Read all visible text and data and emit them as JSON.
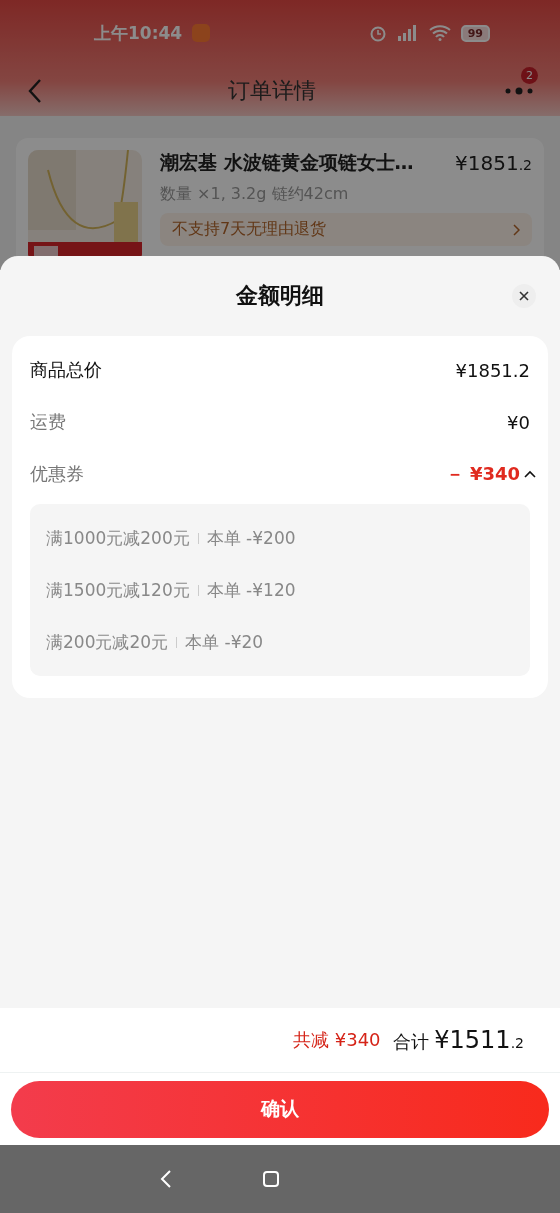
{
  "status_bar": {
    "time": "上午10:44",
    "battery": "99"
  },
  "header": {
    "title": "订单详情",
    "badge": "2"
  },
  "product": {
    "name": "潮宏基 水波链黄金项链女士…",
    "price": "¥1851.2",
    "specs": "数量 ×1, 3.2g 链约42cm",
    "notice": "不支持7天无理由退货"
  },
  "sheet": {
    "title": "金额明细",
    "rows": [
      {
        "label": "商品总价",
        "value": "¥1851.2",
        "kind": "total"
      },
      {
        "label": "运费",
        "value": "¥0",
        "kind": "plain"
      },
      {
        "label": "优惠券",
        "value": "－ ¥340",
        "kind": "discount",
        "expanded": true
      }
    ],
    "coupons": [
      {
        "name": "满1000元减200元",
        "amount": "本单 -¥200"
      },
      {
        "name": "满1500元减120元",
        "amount": "本单 -¥120"
      },
      {
        "name": "满200元减20元",
        "amount": "本单 -¥20"
      }
    ]
  },
  "footer": {
    "saved_label": "共减",
    "saved": "¥340",
    "total_label": "合计",
    "total": "¥1511.2",
    "confirm": "确认"
  }
}
